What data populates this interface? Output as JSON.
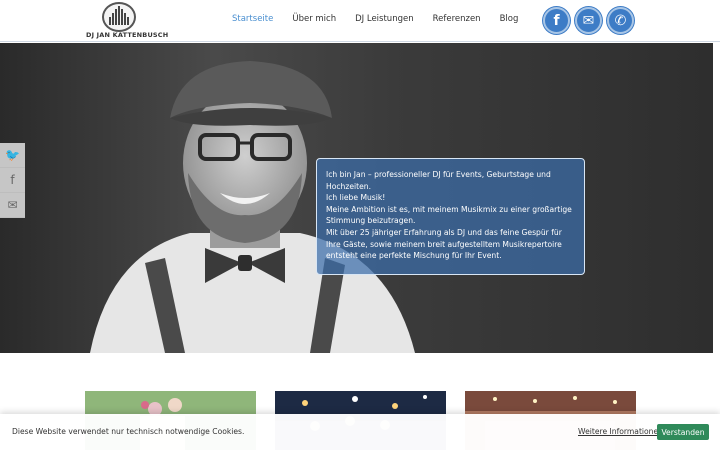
{
  "header": {
    "logo_text": "DJ JAN KATTENBUSCH",
    "nav": [
      {
        "label": "Startseite",
        "active": true
      },
      {
        "label": "Über mich"
      },
      {
        "label": "DJ Leistungen"
      },
      {
        "label": "Referenzen"
      },
      {
        "label": "Blog"
      }
    ],
    "social": [
      {
        "icon": "facebook-icon",
        "glyph": "f"
      },
      {
        "icon": "mail-icon",
        "glyph": "✉"
      },
      {
        "icon": "phone-icon",
        "glyph": "✆"
      }
    ]
  },
  "share": [
    {
      "icon": "twitter-icon",
      "glyph": "🐦"
    },
    {
      "icon": "facebook-icon",
      "glyph": "f"
    },
    {
      "icon": "mail-icon",
      "glyph": "✉"
    }
  ],
  "intro": {
    "lines": [
      "Ich bin Jan – professioneller DJ für Events, Geburtstage und Hochzeiten.",
      "Ich liebe Musik!",
      "Meine Ambition ist es, mit meinem Musikmix zu einer großartige Stimmung beizutragen.",
      "Mit über 25 jähriger Erfahrung als DJ und das feine Gespür für Ihre Gäste, sowie meinem breit aufgestelltem Musikrepertoire entsteht eine perfekte  Mischung für Ihr Event."
    ]
  },
  "cookie": {
    "text": "Diese Website verwendet nur technisch notwendige Cookies.",
    "link": "Weitere Informationen",
    "button": "Verstanden"
  },
  "colors": {
    "accent": "#4a8fd0",
    "social_blue": "#3d7cc6",
    "cookie_button": "#2f8a5a"
  }
}
